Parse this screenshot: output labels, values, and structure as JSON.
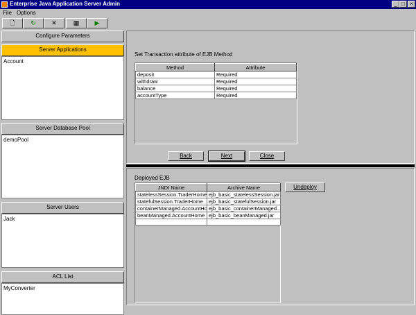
{
  "window": {
    "title": "Enterprise Java Application Server Admin",
    "controls": {
      "minimize": "_",
      "maximize": "□",
      "close": "×"
    }
  },
  "menu": [
    "File",
    "Options"
  ],
  "toolbar": [
    {
      "icon": "new-document-icon",
      "glyph": "🗋"
    },
    {
      "icon": "refresh-document-icon",
      "glyph": "↻"
    },
    {
      "icon": "delete-icon",
      "glyph": "✕"
    },
    {
      "icon": "calendar-icon",
      "glyph": "▦"
    },
    {
      "icon": "run-icon",
      "glyph": "▶"
    }
  ],
  "sidebar": {
    "configure_header": "Configure Parameters",
    "server_applications": {
      "header": "Server Applications",
      "items": [
        "Account"
      ]
    },
    "database_pool": {
      "header": "Server Database Pool",
      "items": [
        "demoPool"
      ]
    },
    "users": {
      "header": "Server Users",
      "items": [
        "Jack"
      ]
    },
    "acl": {
      "header": "ACL List",
      "items": [
        "MyConverter"
      ]
    }
  },
  "transaction": {
    "heading": "Set Transaction attribute of EJB Method",
    "columns": [
      "Method",
      "Attribute"
    ],
    "rows": [
      [
        "deposit",
        "Required"
      ],
      [
        "withdraw",
        "Required"
      ],
      [
        "balance",
        "Required"
      ],
      [
        "accountType",
        "Required"
      ]
    ],
    "buttons": {
      "back": "Back",
      "next": "Next",
      "close": "Close"
    }
  },
  "deployed": {
    "heading": "Deployed EJB",
    "columns": [
      "JNDI Name",
      "Archive Name"
    ],
    "rows": [
      [
        "statelessSession.TraderHome",
        "ejb_basic_statelessSession.jar"
      ],
      [
        "statefulSession.TraderHome",
        "ejb_basic_statefulSession.jar"
      ],
      [
        "containerManaged.AccountHo...",
        "ejb_basic_containerManaged..."
      ],
      [
        "beanManaged.AccountHome",
        "ejb_basic_beanManaged.jar"
      ]
    ],
    "undeploy": "Undeploy"
  }
}
